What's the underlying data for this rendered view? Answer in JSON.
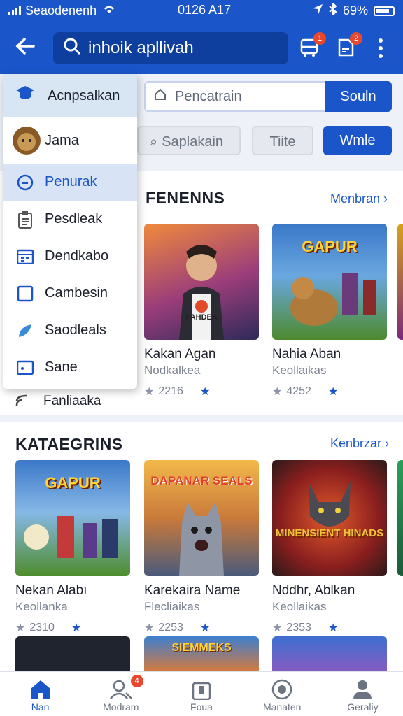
{
  "status": {
    "carrier": "Seaodenenh",
    "time": "0126 A17",
    "battery": "69%"
  },
  "appbar": {
    "search_text": "inhoik apllivah",
    "badge1": "1",
    "badge2": "2"
  },
  "filters": {
    "field_placeholder": "Pencatrain",
    "field_button": "Souln",
    "chip1": "Saplakain",
    "chip2": "Tiite",
    "chip3": "Wmle"
  },
  "drawer": {
    "header": "Acnpsalkan",
    "items": [
      {
        "label": "Jama",
        "icon": "avatar"
      },
      {
        "label": "Penurak",
        "icon": "circle-icon"
      },
      {
        "label": "Pesdleak",
        "icon": "clipboard-icon"
      },
      {
        "label": "Dendkabo",
        "icon": "calendar-icon"
      },
      {
        "label": "Cambesin",
        "icon": "square-icon"
      },
      {
        "label": "Saodleals",
        "icon": "leaf-icon"
      },
      {
        "label": "Sane",
        "icon": "card-icon"
      }
    ],
    "below_item": "Fanliaaka"
  },
  "section1": {
    "title": "FENENNS",
    "more": "Menbran",
    "cards": [
      {
        "title": "Kakan Agan",
        "sub": "Nodkalkea",
        "count": "2216",
        "cap": "PAHDEA",
        "colors": [
          "#e8743a",
          "#4a2a6a"
        ]
      },
      {
        "title": "Nahia Aban",
        "sub": "Keollaikas",
        "count": "4252",
        "cap": "GAPUR",
        "colors": [
          "#3b78c8",
          "#4e8a2c"
        ]
      }
    ]
  },
  "section2": {
    "title": "KATAEGRINS",
    "more": "Kenbrzar",
    "cards": [
      {
        "title": "Nekan Alabı",
        "sub": "Keollanka",
        "count": "2310",
        "cap": "GAPUR",
        "colors": [
          "#3b78c8",
          "#4f8d2d"
        ]
      },
      {
        "title": "Karekaira  Name",
        "sub": "Flecliaikas",
        "count": "2253",
        "cap": "DAPANAR SEALS",
        "colors": [
          "#e9a63a",
          "#5c6b8a"
        ]
      },
      {
        "title": "Nddhr, Ablkan",
        "sub": "Keollaikas",
        "count": "2353",
        "cap": "MINENSIENT HINADS",
        "colors": [
          "#c23a2a",
          "#3a2a2a"
        ]
      }
    ]
  },
  "section3": {
    "colors": [
      "#20242e",
      "#e07a32",
      "#3d6fd0"
    ],
    "cap2": "SIEMMEKS"
  },
  "bottomnav": {
    "items": [
      {
        "label": "Nan",
        "icon": "home-icon"
      },
      {
        "label": "Modram",
        "icon": "people-icon",
        "badge": "4"
      },
      {
        "label": "Foua",
        "icon": "bag-icon"
      },
      {
        "label": "Manaten",
        "icon": "target-icon"
      },
      {
        "label": "Geraliy",
        "icon": "person-icon"
      }
    ]
  }
}
